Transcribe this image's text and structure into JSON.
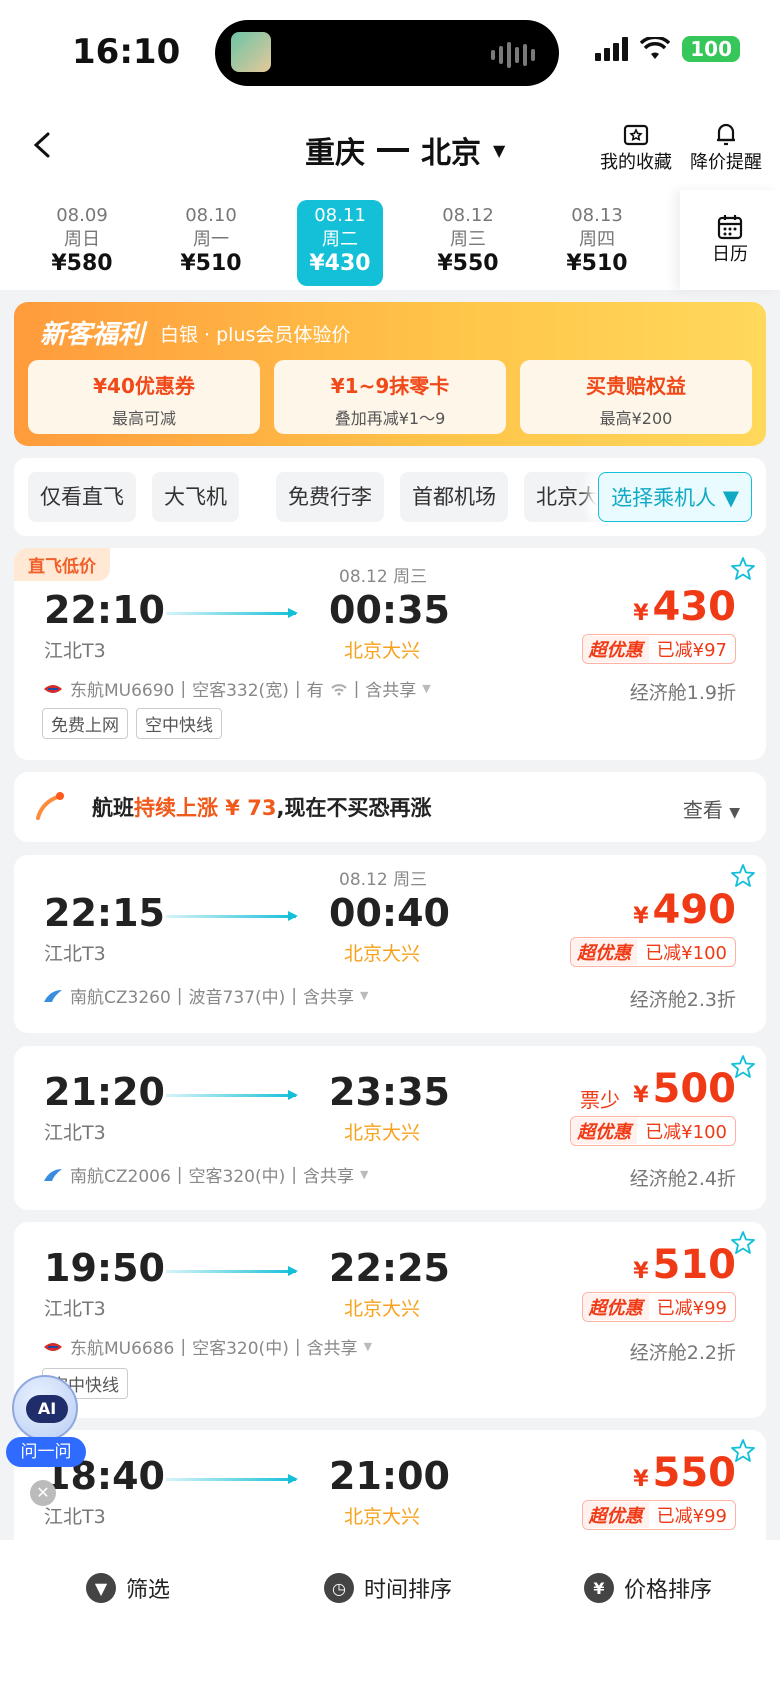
{
  "status_bar": {
    "time": "16:10",
    "battery": "100"
  },
  "header": {
    "from": "重庆",
    "to": "北京",
    "favorites": "我的收藏",
    "price_alert": "降价提醒"
  },
  "dates": [
    {
      "date": "08.09",
      "weekday": "周日",
      "price": "¥580"
    },
    {
      "date": "08.10",
      "weekday": "周一",
      "price": "¥510"
    },
    {
      "date": "08.11",
      "weekday": "周二",
      "price": "¥430"
    },
    {
      "date": "08.12",
      "weekday": "周三",
      "price": "¥550"
    },
    {
      "date": "08.13",
      "weekday": "周四",
      "price": "¥510"
    }
  ],
  "selected_date_index": 2,
  "calendar_label": "日历",
  "promo": {
    "title": "新客福利",
    "subtitle": "白银 · plus会员体验价",
    "coupons": [
      {
        "title": "¥40优惠券",
        "desc": "最高可减"
      },
      {
        "title": "¥1~9抹零卡",
        "desc": "叠加再减¥1～9"
      },
      {
        "title": "买贵赔权益",
        "desc": "最高¥200"
      }
    ]
  },
  "filters": [
    "仅看直飞",
    "大飞机",
    "免费行李",
    "首都机场",
    "北京大兴"
  ],
  "passenger_select": "选择乘机人",
  "rise_banner": {
    "prefix": "航班",
    "highlight": "持续上涨 ¥ 73",
    "suffix": ",现在不买恐再涨",
    "action": "查看"
  },
  "flights": [
    {
      "tag": "直飞低价",
      "arr_date": "08.12 周三",
      "dep": "22:10",
      "arr": "00:35",
      "dep_airport": "江北T3",
      "arr_airport": "北京大兴",
      "currency": "¥",
      "price": "430",
      "few": "",
      "deal": "超优惠",
      "reduce": "已减¥97",
      "airline": "东航MU6690",
      "plane": "空客332(宽)",
      "extra": "有",
      "share": "含共享",
      "cabin": "经济舱1.9折",
      "features": [
        "免费上网",
        "空中快线"
      ]
    },
    {
      "tag": "",
      "arr_date": "08.12 周三",
      "dep": "22:15",
      "arr": "00:40",
      "dep_airport": "江北T3",
      "arr_airport": "北京大兴",
      "currency": "¥",
      "price": "490",
      "few": "",
      "deal": "超优惠",
      "reduce": "已减¥100",
      "airline": "南航CZ3260",
      "plane": "波音737(中)",
      "extra": "",
      "share": "含共享",
      "cabin": "经济舱2.3折",
      "features": []
    },
    {
      "tag": "",
      "arr_date": "",
      "dep": "21:20",
      "arr": "23:35",
      "dep_airport": "江北T3",
      "arr_airport": "北京大兴",
      "currency": "¥",
      "price": "500",
      "few": "票少",
      "deal": "超优惠",
      "reduce": "已减¥100",
      "airline": "南航CZ2006",
      "plane": "空客320(中)",
      "extra": "",
      "share": "含共享",
      "cabin": "经济舱2.4折",
      "features": []
    },
    {
      "tag": "",
      "arr_date": "",
      "dep": "19:50",
      "arr": "22:25",
      "dep_airport": "江北T3",
      "arr_airport": "北京大兴",
      "currency": "¥",
      "price": "510",
      "few": "",
      "deal": "超优惠",
      "reduce": "已减¥99",
      "airline": "东航MU6686",
      "plane": "空客320(中)",
      "extra": "",
      "share": "含共享",
      "cabin": "经济舱2.2折",
      "features": [
        "空中快线"
      ]
    },
    {
      "tag": "",
      "arr_date": "",
      "dep": "18:40",
      "arr": "21:00",
      "dep_airport": "江北T3",
      "arr_airport": "北京大兴",
      "currency": "¥",
      "price": "550",
      "few": "",
      "deal": "超优惠",
      "reduce": "已减¥99",
      "airline": "",
      "plane": "",
      "extra": "",
      "share": "",
      "cabin": "",
      "features": []
    }
  ],
  "ai_assistant": {
    "face": "AI",
    "label": "问一问"
  },
  "bottom_bar": {
    "filter": "筛选",
    "time_sort": "时间排序",
    "price_sort": "价格排序"
  },
  "colors": {
    "accent": "#14bfd8",
    "price": "#f03a16",
    "arrival_airport": "#f7a21b"
  }
}
